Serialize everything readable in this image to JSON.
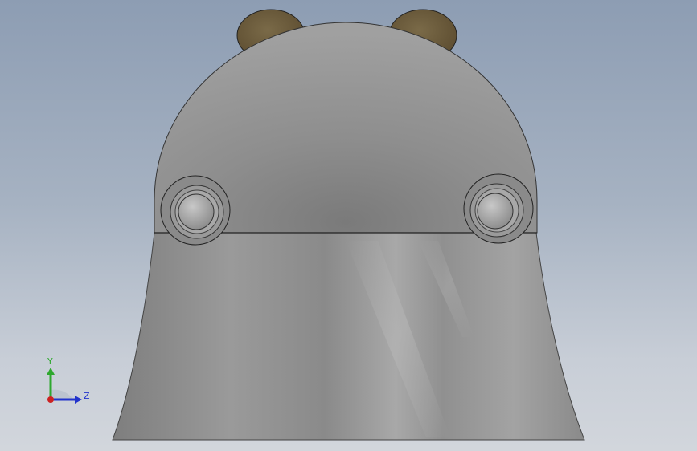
{
  "viewport": {
    "background_top": "#8d9db3",
    "background_bottom": "#d2d6dc"
  },
  "model": {
    "body_color": "#8c8c8c",
    "ear_color": "#6b5a3a"
  },
  "triad": {
    "y_label": "Y",
    "z_label": "Z",
    "y_color": "#2ea82e",
    "z_color": "#2233cc",
    "x_color": "#cc2222"
  }
}
